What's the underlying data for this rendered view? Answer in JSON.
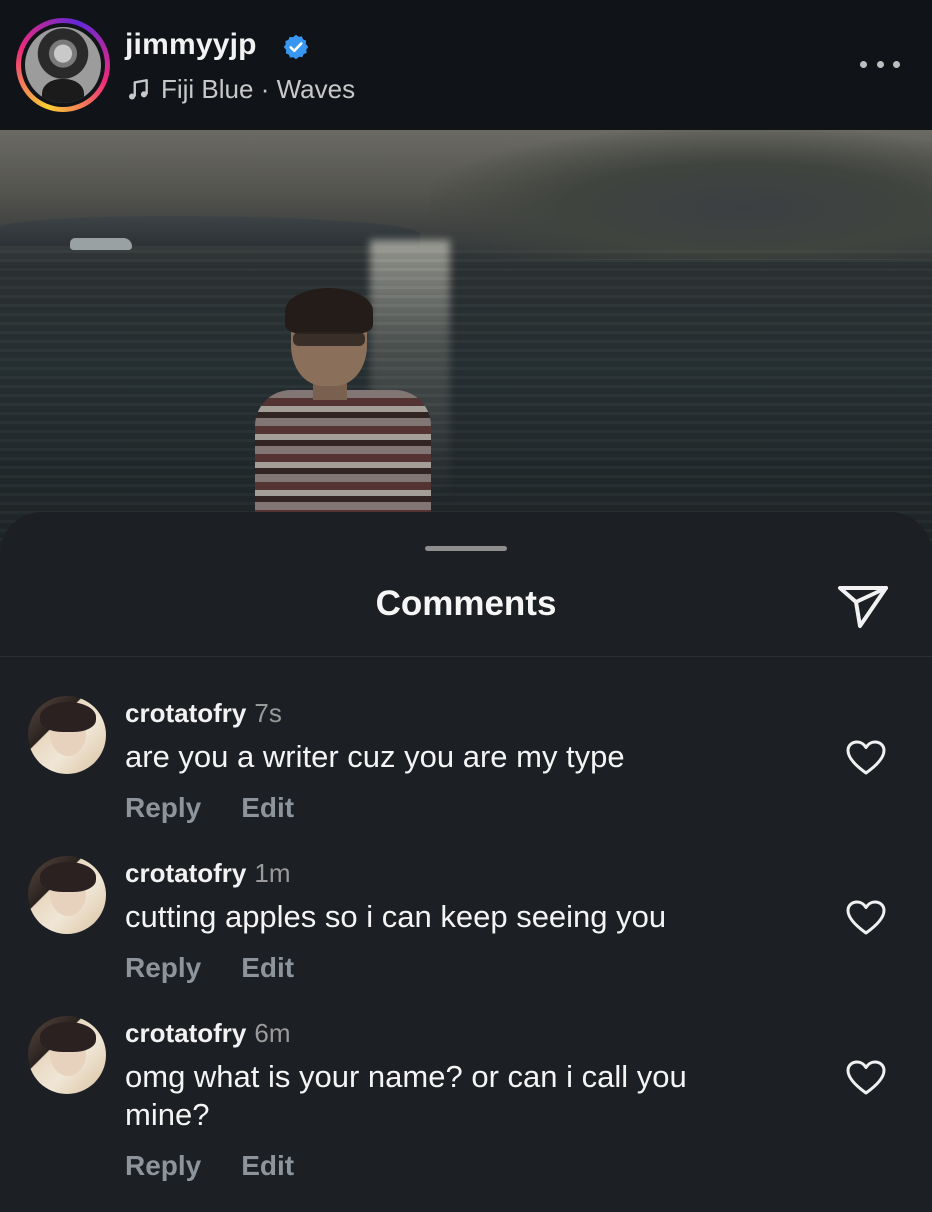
{
  "story": {
    "username": "jimmyyjp",
    "verified": true,
    "music": "Fiji Blue · Waves",
    "icons": {
      "verified": "verified-badge-icon",
      "music": "music-note-icon",
      "more": "more-options-icon"
    }
  },
  "comments_sheet": {
    "title": "Comments",
    "share_icon": "send-icon",
    "items": [
      {
        "user": "crotatofry",
        "time": "7s",
        "text": "are you a writer cuz you are my type",
        "reply": "Reply",
        "edit": "Edit"
      },
      {
        "user": "crotatofry",
        "time": "1m",
        "text": "cutting apples so i can keep seeing you",
        "reply": "Reply",
        "edit": "Edit"
      },
      {
        "user": "crotatofry",
        "time": "6m",
        "text": "omg what is your name? or can i call you mine?",
        "reply": "Reply",
        "edit": "Edit"
      }
    ]
  },
  "colors": {
    "sheet_bg": "#1c1f23",
    "header_bg": "#101317",
    "verified_blue": "#3897f0",
    "muted_text": "#8d949c"
  }
}
